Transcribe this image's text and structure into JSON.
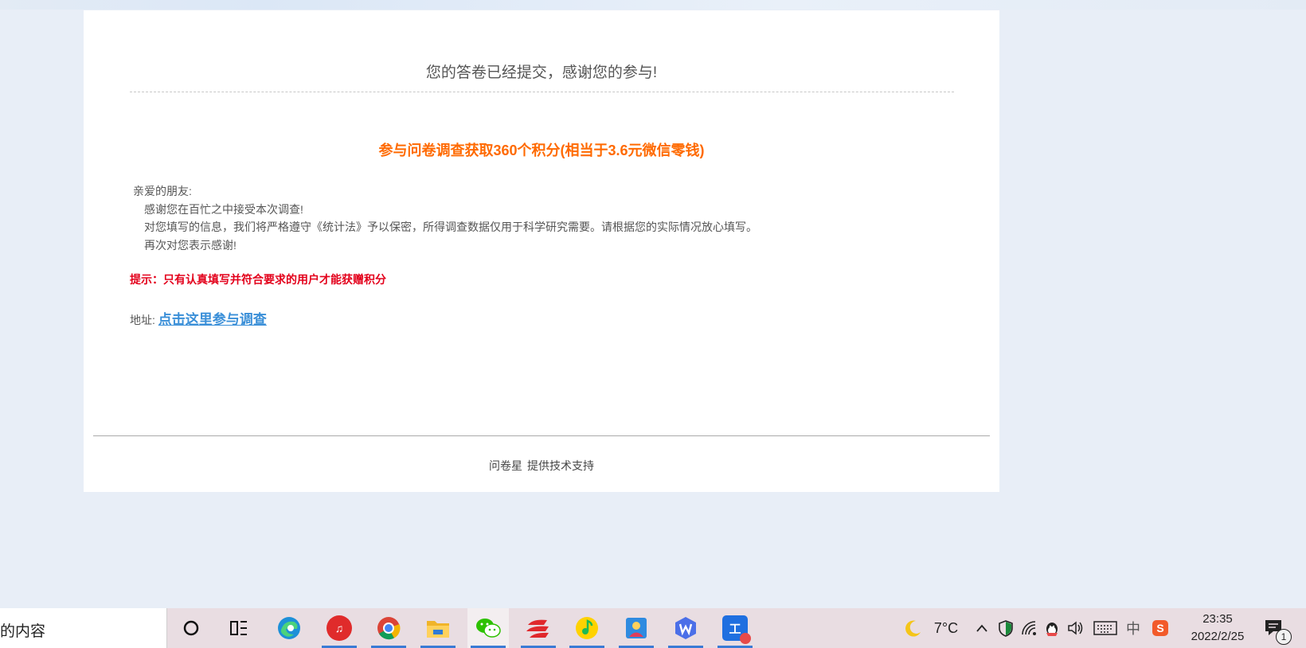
{
  "survey": {
    "success_message": "您的答卷已经提交，感谢您的参与!",
    "promo_title": "参与问卷调查获取360个积分(相当于3.6元微信零钱)",
    "letter": {
      "greeting": "亲爱的朋友:",
      "line1": "感谢您在百忙之中接受本次调查!",
      "line2": "对您填写的信息，我们将严格遵守《统计法》予以保密，所得调查数据仅用于科学研究需要。请根据您的实际情况放心填写。",
      "line3": "再次对您表示感谢!"
    },
    "tip": "提示：只有认真填写并符合要求的用户才能获赠积分",
    "address_label": "地址:",
    "address_link": "点击这里参与调查",
    "footer_brand": "问卷星",
    "footer_text": "提供技术支持"
  },
  "taskbar": {
    "search_text": "的内容",
    "weather_temp": "7°C",
    "ime_lang": "中",
    "time": "23:35",
    "date": "2022/2/25",
    "notification_count": "1",
    "colors": {
      "accent": "#3a7bd5",
      "netease": "#e02b2b",
      "wps": "#4b6fe8",
      "photos": "#2f8be0"
    }
  }
}
